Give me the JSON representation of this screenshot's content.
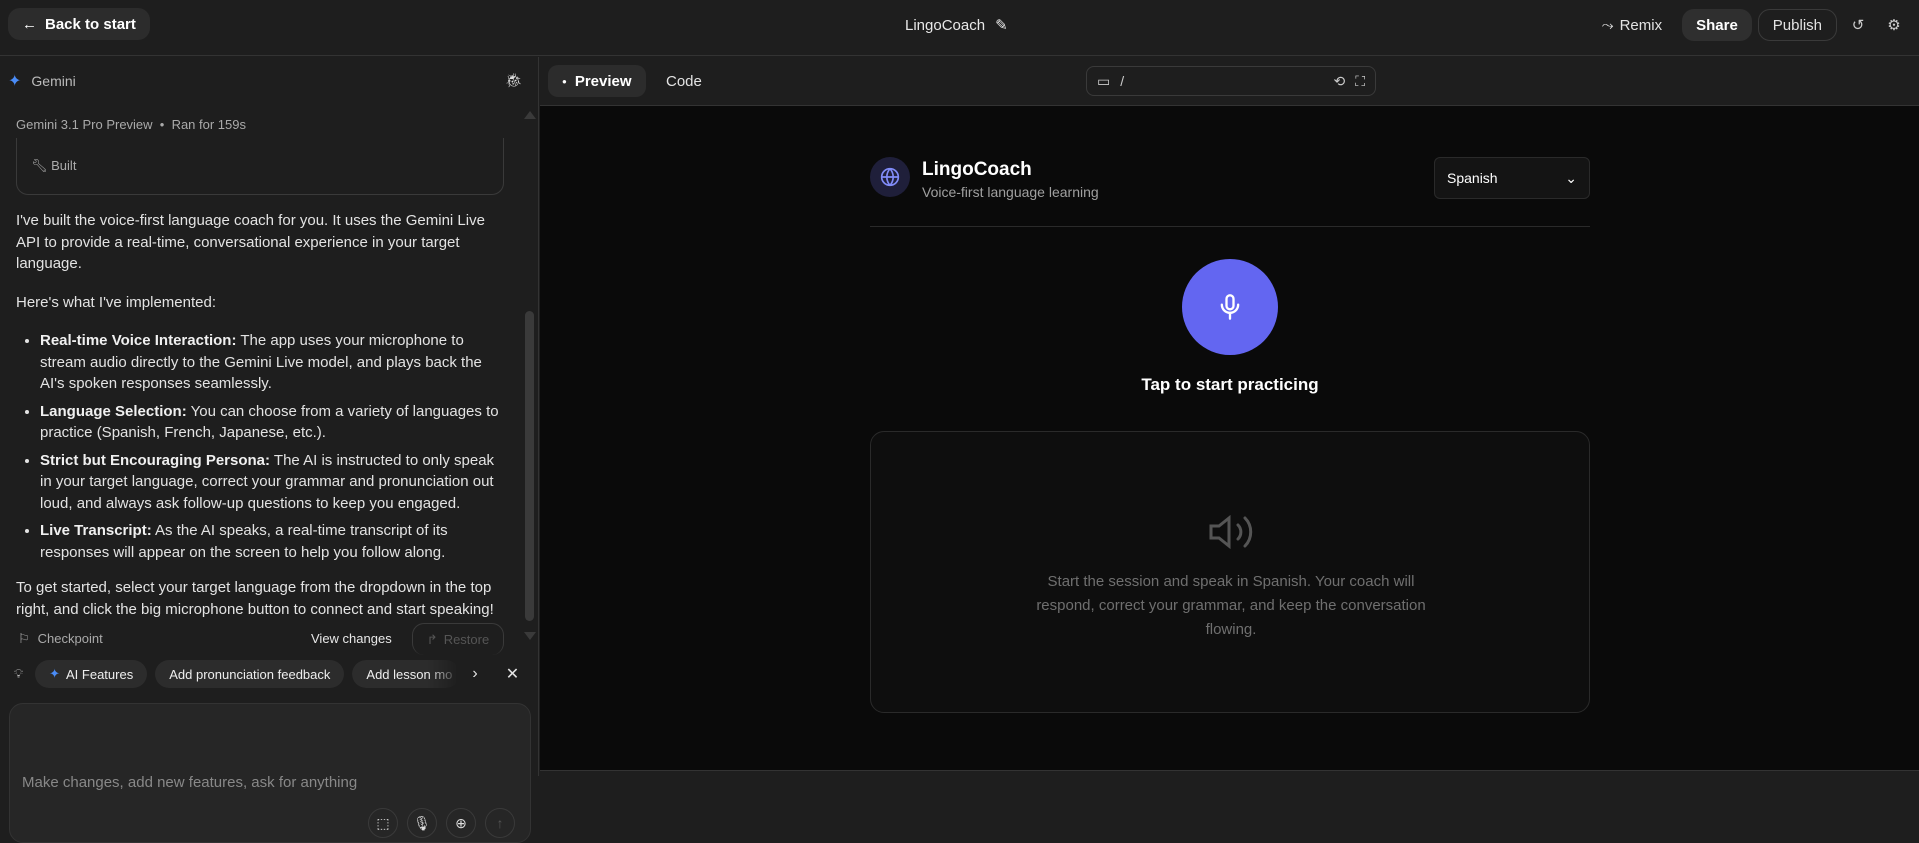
{
  "topbar": {
    "back_label": "Back to start",
    "project_title": "LingoCoach",
    "remix_label": "Remix",
    "share_label": "Share",
    "publish_label": "Publish"
  },
  "chat": {
    "header": "Gemini",
    "meta_model": "Gemini 3.1 Pro Preview",
    "meta_run": "Ran for 159s",
    "built_label": "Built",
    "intro": "I've built the voice-first language coach for you. It uses the Gemini Live API to provide a real-time, conversational experience in your target language.",
    "implemented_heading": "Here's what I've implemented:",
    "features": [
      {
        "title": "Real-time Voice Interaction:",
        "text": " The app uses your microphone to stream audio directly to the Gemini Live model, and plays back the AI's spoken responses seamlessly."
      },
      {
        "title": "Language Selection:",
        "text": " You can choose from a variety of languages to practice (Spanish, French, Japanese, etc.)."
      },
      {
        "title": "Strict but Encouraging Persona:",
        "text": " The AI is instructed to only speak in your target language, correct your grammar and pronunciation out loud, and always ask follow-up questions to keep you engaged."
      },
      {
        "title": "Live Transcript:",
        "text": " As the AI speaks, a real-time transcript of its responses will appear on the screen to help you follow along."
      }
    ],
    "closing": "To get started, select your target language from the dropdown in the top right, and click the big microphone button to connect and start speaking!",
    "checkpoint_label": "Checkpoint",
    "view_changes_label": "View changes",
    "restore_label": "Restore",
    "suggestions": [
      "AI Features",
      "Add pronunciation feedback",
      "Add lesson mo"
    ],
    "input_placeholder": "Make changes, add new features, ask for anything"
  },
  "preview": {
    "tabs": [
      "Preview",
      "Code"
    ],
    "url": "/",
    "app": {
      "name": "LingoCoach",
      "subtitle": "Voice-first language learning",
      "language": "Spanish",
      "tap_label": "Tap to start practicing",
      "transcript_placeholder": "Start the session and speak in Spanish. Your coach will respond, correct your grammar, and keep the conversation flowing."
    }
  },
  "colors": {
    "accent": "#6366f1",
    "gemini_blue": "#4a8cf7"
  }
}
